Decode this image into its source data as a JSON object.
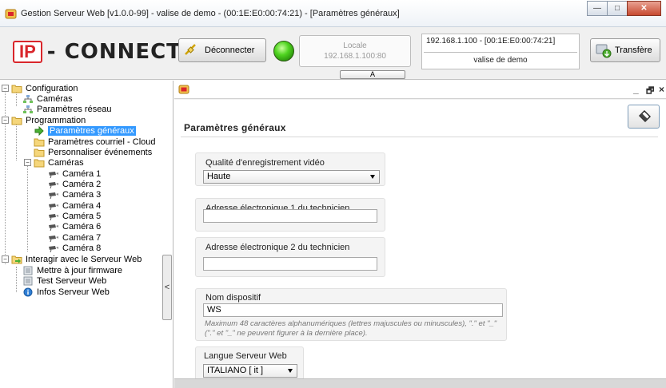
{
  "window": {
    "title": "Gestion Serveur Web [v1.0.0-99] - valise de demo - (00:1E:E0:00:74:21) - [Paramètres généraux]",
    "controls": {
      "minimize": "—",
      "maximize": "□",
      "close": "✕"
    }
  },
  "header": {
    "logo_mark": "IP",
    "logo_text": "- CONNECT",
    "disconnect_label": "Déconnecter",
    "status_color": "#3fc41a",
    "locale_label": "Locale",
    "locale_ip": "192.168.1.100:80",
    "server_line": "192.168.1.100 - [00:1E:E0:00:74:21]",
    "device_name": "valise de demo",
    "transfer_label": "Transfère",
    "collapse_label": "A"
  },
  "tree": {
    "items": [
      {
        "label": "Configuration",
        "icon": "folder-icon"
      },
      {
        "label": "Caméras",
        "icon": "network-icon"
      },
      {
        "label": "Paramètres réseau",
        "icon": "network-icon"
      },
      {
        "label": "Programmation",
        "icon": "folder-icon"
      },
      {
        "label": "Paramètres généraux",
        "icon": "arrow-right-icon",
        "selected": true
      },
      {
        "label": "Paramètres courriel - Cloud",
        "icon": "folder-icon"
      },
      {
        "label": "Personnaliser événements",
        "icon": "folder-icon"
      },
      {
        "label": "Caméras",
        "icon": "folder-icon"
      },
      {
        "label": "Caméra 1",
        "icon": "camera-icon"
      },
      {
        "label": "Caméra 2",
        "icon": "camera-icon"
      },
      {
        "label": "Caméra 3",
        "icon": "camera-icon"
      },
      {
        "label": "Caméra 4",
        "icon": "camera-icon"
      },
      {
        "label": "Caméra 5",
        "icon": "camera-icon"
      },
      {
        "label": "Caméra 6",
        "icon": "camera-icon"
      },
      {
        "label": "Caméra 7",
        "icon": "camera-icon"
      },
      {
        "label": "Caméra 8",
        "icon": "camera-icon"
      },
      {
        "label": "Interagir avec le Serveur Web",
        "icon": "folder-arrow-icon"
      },
      {
        "label": "Mettre à jour firmware",
        "icon": "server-icon"
      },
      {
        "label": "Test Serveur Web",
        "icon": "server-icon"
      },
      {
        "label": "Infos Serveur Web",
        "icon": "info-icon"
      }
    ],
    "splitter_glyph": "<"
  },
  "content": {
    "window_controls": {
      "minimize": "_",
      "restore": "🗗",
      "close": "×"
    },
    "page_title": "Paramètres généraux",
    "video_quality": {
      "label": "Qualité d'enregistrement vidéo",
      "value": "Haute"
    },
    "tech_email_1": {
      "label": "Adresse électronique 1 du technicien",
      "value": ""
    },
    "tech_email_2": {
      "label": "Adresse électronique 2 du technicien",
      "value": ""
    },
    "device_name": {
      "label": "Nom dispositif",
      "value": "WS",
      "hint": "Maximum 48 caractères alphanumériques (lettres majuscules ou minuscules), \".\" et \"_\" (\".\" et \"_\" ne peuvent figurer à la dernière place)."
    },
    "language": {
      "label": "Langue Serveur Web",
      "value": "ITALIANO [ it ]"
    }
  }
}
